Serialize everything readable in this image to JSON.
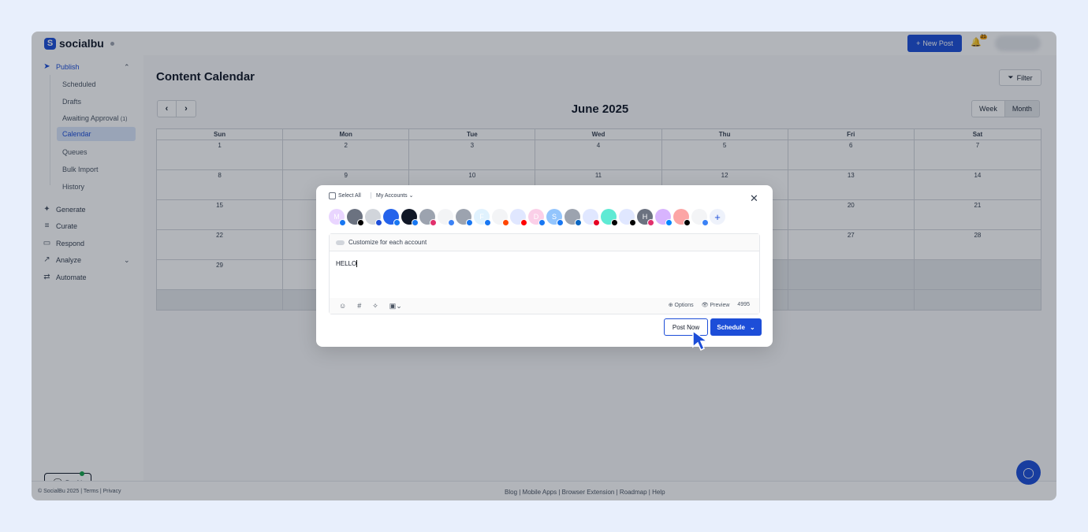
{
  "brand": {
    "name": "socialbu"
  },
  "topbar": {
    "new_post_label": "New Post",
    "notifications_count": "21"
  },
  "sidebar": {
    "publish": "Publish",
    "publish_sub": [
      "Scheduled",
      "Drafts",
      "Awaiting Approval",
      "Calendar",
      "Queues",
      "Bulk Import",
      "History"
    ],
    "awaiting_count": "(1)",
    "generate": "Generate",
    "curate": "Curate",
    "respond": "Respond",
    "analyze": "Analyze",
    "automate": "Automate",
    "bu_ai": "Bu AI"
  },
  "main": {
    "title": "Content Calendar",
    "filter_label": "Filter",
    "month": "June 2025",
    "view_week": "Week",
    "view_month": "Month",
    "weekdays": [
      "Sun",
      "Mon",
      "Tue",
      "Wed",
      "Thu",
      "Fri",
      "Sat"
    ],
    "weeks": [
      [
        "1",
        "2",
        "3",
        "4",
        "5",
        "6",
        "7"
      ],
      [
        "8",
        "9",
        "10",
        "11",
        "12",
        "13",
        "14"
      ],
      [
        "15",
        "",
        "",
        "",
        "",
        "20",
        "21"
      ],
      [
        "22",
        "",
        "",
        "",
        "",
        "27",
        "28"
      ],
      [
        "29",
        "",
        "",
        "",
        "",
        "",
        ""
      ]
    ]
  },
  "footer": {
    "left": "© SocialBu 2025 | Terms | Privacy",
    "center": "Blog | Mobile Apps | Browser Extension | Roadmap | Help"
  },
  "modal": {
    "select_all": "Select All",
    "my_accounts": "My Accounts",
    "customize_label": "Customize for each account",
    "post_text": "HELLO",
    "options_label": "Options",
    "preview_label": "Preview",
    "char_count": "4995",
    "post_now_label": "Post Now",
    "schedule_label": "Schedule",
    "accounts": [
      {
        "letter": "M",
        "bg": "#e9d5ff",
        "badge": "#1877f2"
      },
      {
        "letter": "",
        "bg": "#6b7280",
        "badge": "#000000"
      },
      {
        "letter": "",
        "bg": "#d1d5db",
        "badge": "#1d4ed8"
      },
      {
        "letter": "",
        "bg": "#2563eb",
        "badge": "#1877f2"
      },
      {
        "letter": "",
        "bg": "#111827",
        "badge": "#1877f2"
      },
      {
        "letter": "",
        "bg": "#9ca3af",
        "badge": "#e1306c"
      },
      {
        "letter": "",
        "bg": "#f3f4f6",
        "badge": "#3b82f6"
      },
      {
        "letter": "",
        "bg": "#9ca3af",
        "badge": "#1877f2"
      },
      {
        "letter": "F",
        "bg": "#e0f2fe",
        "badge": "#1877f2"
      },
      {
        "letter": "",
        "bg": "#f3f4f6",
        "badge": "#ff4500"
      },
      {
        "letter": "",
        "bg": "#e0e7ff",
        "badge": "#ff0000"
      },
      {
        "letter": "D",
        "bg": "#fbcfe8",
        "badge": "#1877f2"
      },
      {
        "letter": "S",
        "bg": "#93c5fd",
        "badge": "#1877f2"
      },
      {
        "letter": "",
        "bg": "#9ca3af",
        "badge": "#0a66c2"
      },
      {
        "letter": "",
        "bg": "#e0e7ff",
        "badge": "#e60023"
      },
      {
        "letter": "",
        "bg": "#5eead4",
        "badge": "#000000"
      },
      {
        "letter": "",
        "bg": "#e0e7ff",
        "badge": "#000000"
      },
      {
        "letter": "H",
        "bg": "#6b7280",
        "badge": "#e1306c"
      },
      {
        "letter": "",
        "bg": "#d8b4fe",
        "badge": "#0085ff"
      },
      {
        "letter": "",
        "bg": "#fca5a5",
        "badge": "#000000"
      },
      {
        "letter": "",
        "bg": "#f3f4f6",
        "badge": "#3b82f6"
      }
    ]
  },
  "colors": {
    "brand_blue": "#1d4ed8",
    "overlay": "rgba(17,24,39,0.32)"
  }
}
